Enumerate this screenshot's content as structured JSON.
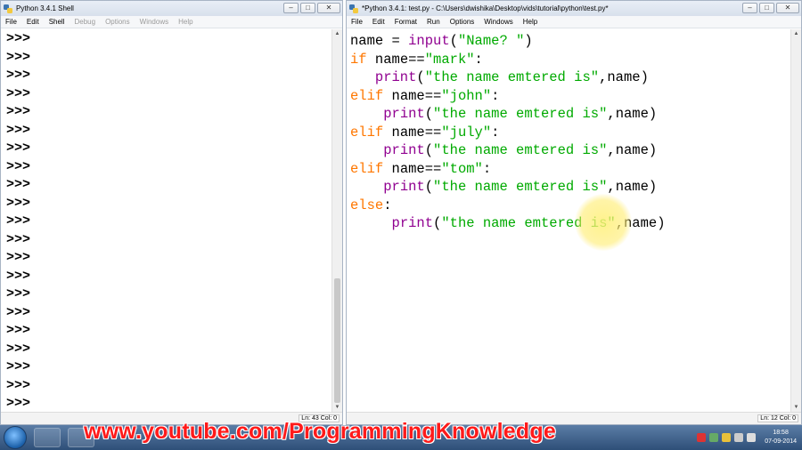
{
  "shell": {
    "title": "Python 3.4.1 Shell",
    "menu": [
      "File",
      "Edit",
      "Shell",
      "Debug",
      "Options",
      "Windows",
      "Help"
    ],
    "prompt": ">>>",
    "prompt_count": 22,
    "status": "Ln: 43  Col: 0"
  },
  "editor": {
    "title": "*Python 3.4.1: test.py - C:\\Users\\dwishika\\Desktop\\vids\\tutorial\\python\\test.py*",
    "menu": [
      "File",
      "Edit",
      "Format",
      "Run",
      "Options",
      "Windows",
      "Help"
    ],
    "code_lines": [
      [
        [
          "",
          "name = "
        ],
        [
          "bi",
          "input"
        ],
        [
          "",
          "("
        ],
        [
          "st",
          "\"Name? \""
        ],
        [
          "",
          ")"
        ]
      ],
      [
        [
          "kw",
          "if"
        ],
        [
          "",
          " name=="
        ],
        [
          "st",
          "\"mark\""
        ],
        [
          "",
          ":"
        ]
      ],
      [
        [
          "",
          "   "
        ],
        [
          "bi",
          "print"
        ],
        [
          "",
          "("
        ],
        [
          "st",
          "\"the name emtered is\""
        ],
        [
          "",
          ",name)"
        ]
      ],
      [
        [
          "kw",
          "elif"
        ],
        [
          "",
          " name=="
        ],
        [
          "st",
          "\"john\""
        ],
        [
          "",
          ":"
        ]
      ],
      [
        [
          "",
          "    "
        ],
        [
          "bi",
          "print"
        ],
        [
          "",
          "("
        ],
        [
          "st",
          "\"the name emtered is\""
        ],
        [
          "",
          ",name)"
        ]
      ],
      [
        [
          "kw",
          "elif"
        ],
        [
          "",
          " name=="
        ],
        [
          "st",
          "\"july\""
        ],
        [
          "",
          ":"
        ]
      ],
      [
        [
          "",
          "    "
        ],
        [
          "bi",
          "print"
        ],
        [
          "",
          "("
        ],
        [
          "st",
          "\"the name emtered is\""
        ],
        [
          "",
          ",name)"
        ]
      ],
      [
        [
          "kw",
          "elif"
        ],
        [
          "",
          " name=="
        ],
        [
          "st",
          "\"tom\""
        ],
        [
          "",
          ":"
        ]
      ],
      [
        [
          "",
          "    "
        ],
        [
          "bi",
          "print"
        ],
        [
          "",
          "("
        ],
        [
          "st",
          "\"the name emtered is\""
        ],
        [
          "",
          ",name)"
        ]
      ],
      [
        [
          "kw",
          "else"
        ],
        [
          "",
          ":"
        ]
      ],
      [
        [
          "",
          "     "
        ],
        [
          "bi",
          "print"
        ],
        [
          "",
          "("
        ],
        [
          "st",
          "\"the name emtered is\""
        ],
        [
          "",
          ",name)"
        ]
      ]
    ],
    "status": "Ln: 12  Col: 0"
  },
  "watermark": "www.youtube.com/ProgrammingKnowledge",
  "clock": {
    "time": "18:58",
    "date": "07-09-2014"
  },
  "colors": {
    "keyword": "#ff7700",
    "builtin": "#900090",
    "string": "#00aa00",
    "watermark": "#ff1a1a"
  }
}
